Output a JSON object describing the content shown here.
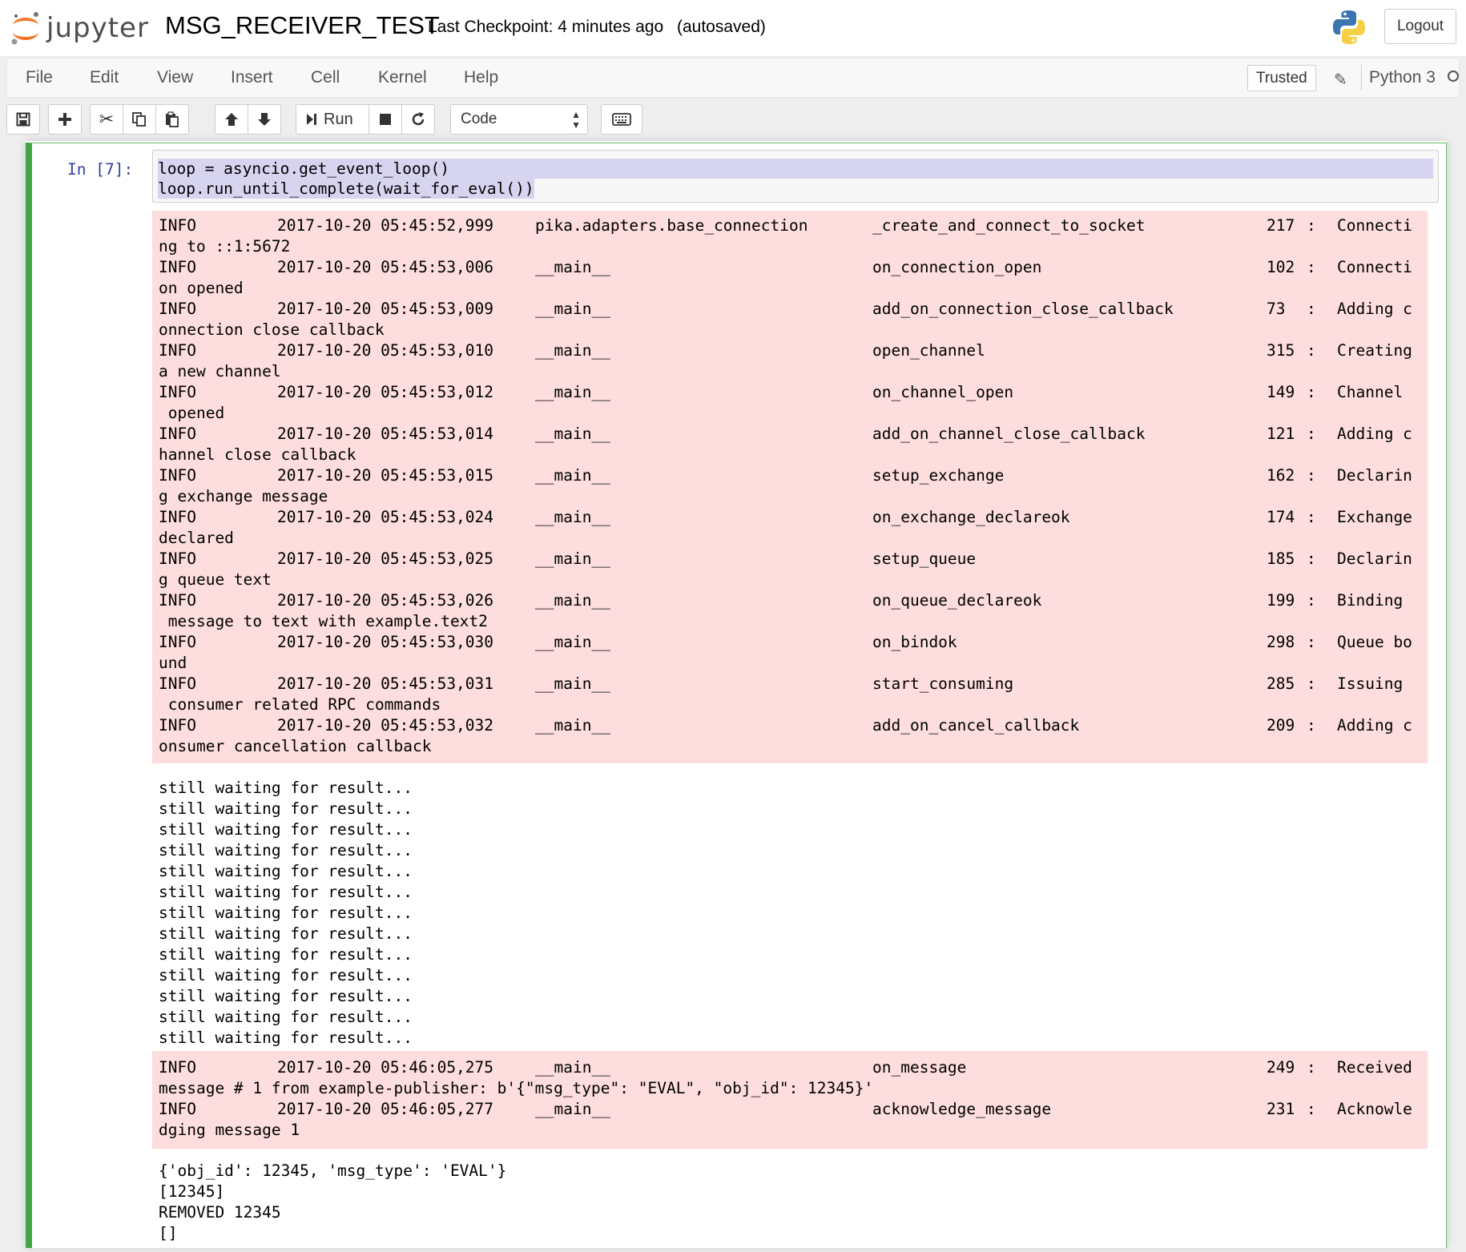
{
  "header": {
    "logo_text": "jupyter",
    "notebook_name": "MSG_RECEIVER_TEST",
    "checkpoint": "Last Checkpoint: 4 minutes ago",
    "autosave": "(autosaved)",
    "logout_label": "Logout"
  },
  "menubar": {
    "items": [
      "File",
      "Edit",
      "View",
      "Insert",
      "Cell",
      "Kernel",
      "Help"
    ],
    "trusted_label": "Trusted",
    "kernel_name": "Python 3"
  },
  "toolbar": {
    "run_label": "Run",
    "cell_type": "Code"
  },
  "cell": {
    "prompt": "In [7]:",
    "code": [
      "loop = asyncio.get_event_loop()",
      "loop.run_until_complete(wait_for_eval())"
    ]
  },
  "outputs": {
    "log_block_1": [
      {
        "level": "INFO",
        "time": "2017-10-20 05:45:52,999",
        "module": "pika.adapters.base_connection",
        "func": "_create_and_connect_to_socket",
        "line": "217",
        "msg_head": "Connecti",
        "msg_tail": "ng to ::1:5672"
      },
      {
        "level": "INFO",
        "time": "2017-10-20 05:45:53,006",
        "module": "__main__",
        "func": "on_connection_open",
        "line": "102",
        "msg_head": "Connecti",
        "msg_tail": "on opened"
      },
      {
        "level": "INFO",
        "time": "2017-10-20 05:45:53,009",
        "module": "__main__",
        "func": "add_on_connection_close_callback",
        "line": "73",
        "msg_head": "Adding c",
        "msg_tail": "onnection close callback"
      },
      {
        "level": "INFO",
        "time": "2017-10-20 05:45:53,010",
        "module": "__main__",
        "func": "open_channel",
        "line": "315",
        "msg_head": "Creating",
        "msg_tail": "a new channel"
      },
      {
        "level": "INFO",
        "time": "2017-10-20 05:45:53,012",
        "module": "__main__",
        "func": "on_channel_open",
        "line": "149",
        "msg_head": "Channel",
        "msg_tail": " opened"
      },
      {
        "level": "INFO",
        "time": "2017-10-20 05:45:53,014",
        "module": "__main__",
        "func": "add_on_channel_close_callback",
        "line": "121",
        "msg_head": "Adding c",
        "msg_tail": "hannel close callback"
      },
      {
        "level": "INFO",
        "time": "2017-10-20 05:45:53,015",
        "module": "__main__",
        "func": "setup_exchange",
        "line": "162",
        "msg_head": "Declarin",
        "msg_tail": "g exchange message"
      },
      {
        "level": "INFO",
        "time": "2017-10-20 05:45:53,024",
        "module": "__main__",
        "func": "on_exchange_declareok",
        "line": "174",
        "msg_head": "Exchange",
        "msg_tail": "declared"
      },
      {
        "level": "INFO",
        "time": "2017-10-20 05:45:53,025",
        "module": "__main__",
        "func": "setup_queue",
        "line": "185",
        "msg_head": "Declarin",
        "msg_tail": "g queue text"
      },
      {
        "level": "INFO",
        "time": "2017-10-20 05:45:53,026",
        "module": "__main__",
        "func": "on_queue_declareok",
        "line": "199",
        "msg_head": "Binding",
        "msg_tail": " message to text with example.text2"
      },
      {
        "level": "INFO",
        "time": "2017-10-20 05:45:53,030",
        "module": "__main__",
        "func": "on_bindok",
        "line": "298",
        "msg_head": "Queue bo",
        "msg_tail": "und"
      },
      {
        "level": "INFO",
        "time": "2017-10-20 05:45:53,031",
        "module": "__main__",
        "func": "start_consuming",
        "line": "285",
        "msg_head": "Issuing",
        "msg_tail": " consumer related RPC commands"
      },
      {
        "level": "INFO",
        "time": "2017-10-20 05:45:53,032",
        "module": "__main__",
        "func": "add_on_cancel_callback",
        "line": "209",
        "msg_head": "Adding c",
        "msg_tail": "onsumer cancellation callback"
      }
    ],
    "stdout_1": [
      "still waiting for result...",
      "still waiting for result...",
      "still waiting for result...",
      "still waiting for result...",
      "still waiting for result...",
      "still waiting for result...",
      "still waiting for result...",
      "still waiting for result...",
      "still waiting for result...",
      "still waiting for result...",
      "still waiting for result...",
      "still waiting for result...",
      "still waiting for result..."
    ],
    "log_block_2": [
      {
        "level": "INFO",
        "time": "2017-10-20 05:46:05,275",
        "module": "__main__",
        "func": "on_message",
        "line": "249",
        "msg_head": "Received",
        "msg_tail": "message # 1 from example-publisher: b'{\"msg_type\": \"EVAL\", \"obj_id\": 12345}'"
      },
      {
        "level": "INFO",
        "time": "2017-10-20 05:46:05,277",
        "module": "__main__",
        "func": "acknowledge_message",
        "line": "231",
        "msg_head": "Acknowle",
        "msg_tail": "dging message 1"
      }
    ],
    "stdout_2": [
      "{'obj_id': 12345, 'msg_type': 'EVAL'}",
      "[12345]",
      "REMOVED 12345",
      "[]"
    ]
  },
  "colors": {
    "stderr_bg": "#fddddd",
    "cell_border": "#42a545",
    "prompt_color": "#303f9f",
    "selection": "#d7d4f0"
  },
  "icons": [
    "save-icon",
    "plus-icon",
    "scissors-icon",
    "copy-icon",
    "paste-icon",
    "arrow-up-icon",
    "arrow-down-icon",
    "run-icon",
    "stop-icon",
    "restart-icon",
    "keyboard-icon",
    "pencil-icon",
    "python-logo",
    "jupyter-logo"
  ]
}
